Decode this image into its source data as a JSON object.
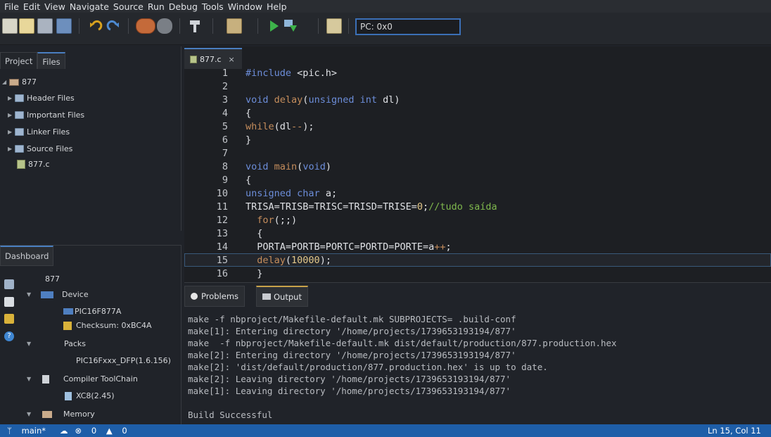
{
  "menu": [
    "File",
    "Edit",
    "View",
    "Navigate",
    "Source",
    "Run",
    "Debug",
    "Tools",
    "Window",
    "Help"
  ],
  "toolbar": {
    "pc_value": "PC: 0x0"
  },
  "projects_panel": {
    "tabs": [
      "Project",
      "Files"
    ],
    "root": "877",
    "items": [
      "Header Files",
      "Important Files",
      "Linker Files",
      "Source Files"
    ],
    "file": "877.c"
  },
  "dashboard": {
    "tab": "Dashboard",
    "project": "877",
    "device_label": "Device",
    "device_name": "PIC16F877A",
    "checksum": "Checksum: 0xBC4A",
    "packs_label": "Packs",
    "pack_name": "PIC16Fxxx_DFP(1.6.156)",
    "compiler_label": "Compiler ToolChain",
    "compiler_name": "XC8(2.45)",
    "memory_label": "Memory"
  },
  "editor": {
    "tab_label": "877.c",
    "tab_close": "×",
    "line_numbers": [
      "1",
      "2",
      "3",
      "4",
      "5",
      "6",
      "7",
      "8",
      "9",
      "10",
      "11",
      "12",
      "13",
      "14",
      "15",
      "16"
    ]
  },
  "output_panel": {
    "tabs": [
      "Problems",
      "Output"
    ],
    "lines": [
      "make -f nbproject/Makefile-default.mk SUBPROJECTS= .build-conf",
      "make[1]: Entering directory '/home/projects/1739653193194/877'",
      "make  -f nbproject/Makefile-default.mk dist/default/production/877.production.hex",
      "make[2]: Entering directory '/home/projects/1739653193194/877'",
      "make[2]: 'dist/default/production/877.production.hex' is up to date.",
      "make[2]: Leaving directory '/home/projects/1739653193194/877'",
      "make[1]: Leaving directory '/home/projects/1739653193194/877'",
      "",
      "Build Successful"
    ]
  },
  "status": {
    "branch": "main*",
    "errors": "0",
    "warnings": "0",
    "position": "Ln 15, Col 11"
  }
}
